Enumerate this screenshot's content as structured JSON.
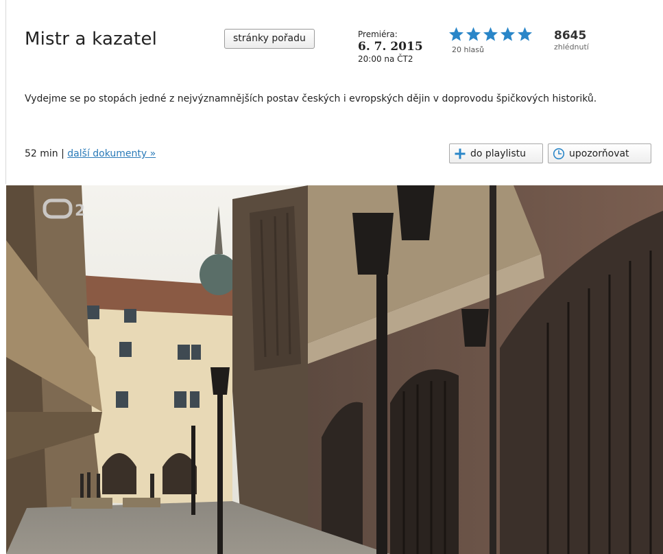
{
  "show": {
    "title": "Mistr a kazatel",
    "show_page_label": "stránky pořadu"
  },
  "premiere": {
    "label": "Premiéra:",
    "date": "6. 7. 2015",
    "time": "20:00 na ČT2"
  },
  "rating": {
    "stars": 5,
    "votes": "20 hlasů",
    "star_color": "#2a86c8"
  },
  "views": {
    "count": "8645",
    "label": "zhlédnutí"
  },
  "description": "Vydejme se po stopách jedné z nejvýznamnějších postav českých i evropských dějin v doprovodu špičkových historiků.",
  "meta": {
    "duration": "52 min",
    "separator": "|",
    "more_link": "další dokumenty »"
  },
  "actions": {
    "playlist_label": "do playlistu",
    "notify_label": "upozorňovat"
  },
  "video": {
    "channel_logo_icon": "ct2-logo-icon"
  },
  "colors": {
    "accent": "#2a86c8",
    "link": "#2a7ab8"
  }
}
